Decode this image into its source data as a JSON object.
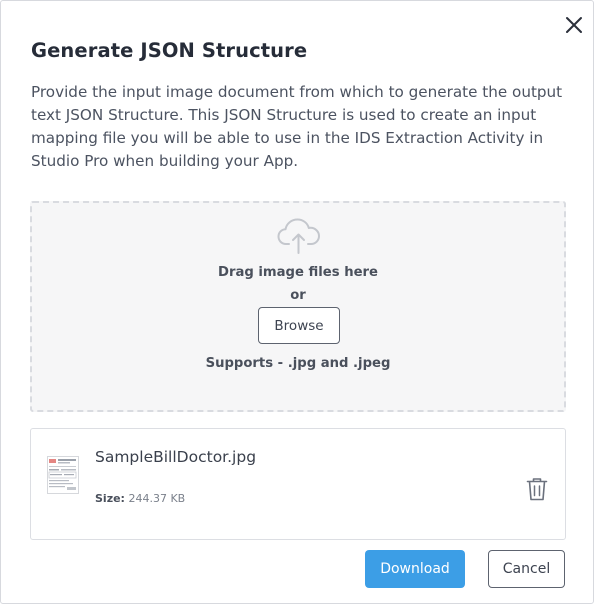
{
  "dialog": {
    "title": "Generate JSON Structure",
    "description": "Provide the input image document from which to generate the output text JSON Structure. This JSON Structure is used to create an input mapping file you will be able to use in the IDS Extraction Activity in Studio Pro when building your App.",
    "close_icon": "close-icon"
  },
  "dropzone": {
    "icon": "cloud-upload-icon",
    "drag_text": "Drag image files here",
    "or_text": "or",
    "browse_label": "Browse",
    "supports_text": "Supports - .jpg and .jpeg"
  },
  "file": {
    "icon": "document-thumbnail-icon",
    "name": "SampleBillDoctor.jpg",
    "size_label": "Size:",
    "size_value": "244.37 KB",
    "delete_icon": "trash-icon"
  },
  "actions": {
    "download_label": "Download",
    "cancel_label": "Cancel"
  },
  "colors": {
    "primary": "#3c9ee6",
    "dropzone_bg": "#f6f6f7",
    "border": "#d9dbe0",
    "text": "#3b4251"
  }
}
